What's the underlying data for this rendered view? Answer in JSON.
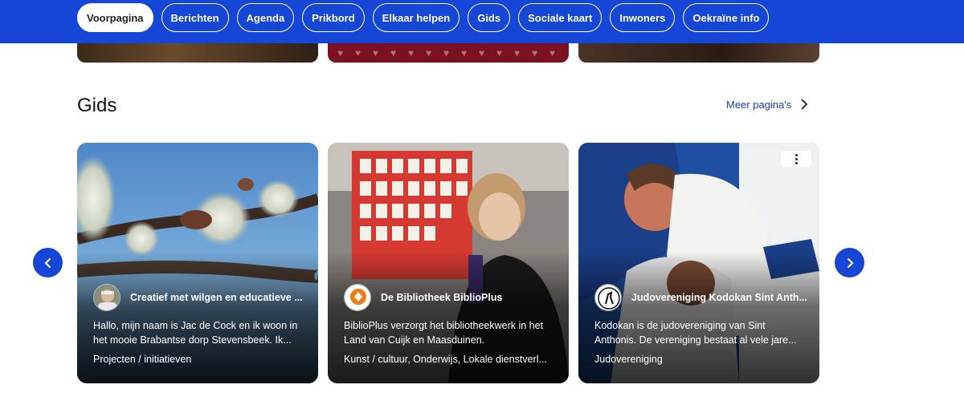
{
  "nav": {
    "items": [
      {
        "label": "Voorpagina",
        "active": true
      },
      {
        "label": "Berichten"
      },
      {
        "label": "Agenda"
      },
      {
        "label": "Prikbord"
      },
      {
        "label": "Elkaar helpen"
      },
      {
        "label": "Gids"
      },
      {
        "label": "Sociale kaart"
      },
      {
        "label": "Inwoners"
      },
      {
        "label": "Oekraïne info"
      }
    ]
  },
  "section": {
    "title": "Gids",
    "more_label": "Meer pagina's"
  },
  "cards": [
    {
      "author": "Creatief met wilgen en educatieve ...",
      "description": "Hallo, mijn naam is Jac de Cock en ik woon in het mooie Brabantse dorp Stevensbeek. Ik...",
      "tags": "Projecten / initiatieven"
    },
    {
      "author": "De Bibliotheek BiblioPlus",
      "description": "BiblioPlus verzorgt het bibliotheekwerk in het Land van Cuijk en Maasduinen.",
      "tags": "Kunst / cultuur, Onderwijs, Lokale dienstverl..."
    },
    {
      "author": "Judovereniging Kodokan Sint Anth...",
      "description": "Kodokan is de judovereniging van Sint Anthonis. De vereniging bestaat al vele jare...",
      "tags": "Judovereniging"
    }
  ],
  "colors": {
    "brand_blue": "#1646d6",
    "link_blue": "#173e9c"
  },
  "icons": {
    "more": "chevron-right-icon",
    "prev": "chevron-left-icon",
    "next": "chevron-right-icon",
    "card_menu": "more-options-icon"
  }
}
